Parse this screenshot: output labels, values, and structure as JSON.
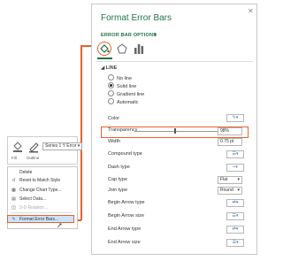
{
  "pane": {
    "title": "Format Error Bars",
    "options_header": "ERROR BAR OPTIONS",
    "line_header": "LINE",
    "line_options": [
      {
        "label": "No line",
        "checked": false
      },
      {
        "label": "Solid line",
        "checked": true
      },
      {
        "label": "Gradient line",
        "checked": false
      },
      {
        "label": "Automatic",
        "checked": false
      }
    ],
    "props": {
      "color": "Color",
      "transparency": "Transparency",
      "transparency_value": "98%",
      "transparency_level": 0.98,
      "width": "Width",
      "width_value": "0.75 pt",
      "compound_type": "Compound type",
      "dash_type": "Dash type",
      "cap_type": "Cap type",
      "cap_value": "Flat",
      "join_type": "Join type",
      "join_value": "Round",
      "begin_arrow_type": "Begin Arrow type",
      "begin_arrow_size": "Begin Arrow size",
      "end_arrow_type": "End Arrow type",
      "end_arrow_size": "End Arrow size"
    }
  },
  "mini_toolbar": {
    "series": "Series 1 Y Error",
    "fill": "Fill",
    "outline": "Outline"
  },
  "context_menu": [
    {
      "label": "Delete",
      "disabled": false
    },
    {
      "label": "Reset to Match Style",
      "disabled": false
    },
    {
      "label": "Change Chart Type...",
      "disabled": false
    },
    {
      "label": "Select Data...",
      "disabled": false
    },
    {
      "label": "3-D Rotation...",
      "disabled": true
    },
    {
      "label": "Format Error Bars...",
      "disabled": false
    }
  ],
  "colors": {
    "accent": "#e8612c",
    "title": "#217346"
  }
}
